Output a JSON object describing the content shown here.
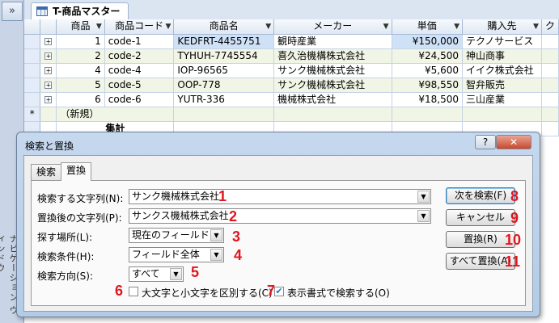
{
  "nav": {
    "toggle": "»",
    "vertical_label": "ナビゲーション ウィンドウ"
  },
  "doc_tab": {
    "title": "T-商品マスター"
  },
  "datasheet": {
    "columns": [
      "商品",
      "商品コード",
      "商品名",
      "メーカー",
      "単価",
      "購入先",
      "ク"
    ],
    "rows": [
      {
        "id": "1",
        "code": "code-1",
        "name": "KEDFRT-4455751",
        "maker": "観時産業",
        "price": "¥150,000",
        "vendor": "テクノサービス"
      },
      {
        "id": "2",
        "code": "code-2",
        "name": "TYHUH-7745554",
        "maker": "喜久治機構株式会社",
        "price": "¥24,500",
        "vendor": "神山商事"
      },
      {
        "id": "4",
        "code": "code-4",
        "name": "IOP-96565",
        "maker": "サンク機械株式会社",
        "price": "¥5,600",
        "vendor": "イイク株式会社"
      },
      {
        "id": "5",
        "code": "code-5",
        "name": "OOP-778",
        "maker": "サンク機械株式会社",
        "price": "¥98,550",
        "vendor": "智弁販売"
      },
      {
        "id": "6",
        "code": "code-6",
        "name": "YUTR-336",
        "maker": "機械株式会社",
        "price": "¥18,500",
        "vendor": "三山産業"
      }
    ],
    "new_record_marker": "*",
    "new_record_label": "（新規）",
    "totals_label": "集計"
  },
  "dialog": {
    "title": "検索と置換",
    "help_button": "?",
    "close_button": "✕",
    "tabs": [
      "検索",
      "置換"
    ],
    "active_tab": "置換",
    "fields": {
      "find_label": "検索する文字列(N):",
      "find_value": "サンク機械株式会社",
      "replace_label": "置換後の文字列(P):",
      "replace_value": "サンクス機械株式会社",
      "look_in_label": "探す場所(L):",
      "look_in_value": "現在のフィールド",
      "match_label": "検索条件(H):",
      "match_value": "フィールド全体",
      "search_label": "検索方向(S):",
      "search_value": "すべて",
      "match_case_label": "大文字と小文字を区別する(C)",
      "match_case_checked": false,
      "search_formatted_label": "表示書式で検索する(O)",
      "search_formatted_checked": true
    },
    "buttons": {
      "find_next": "次を検索(F)",
      "cancel": "キャンセル",
      "replace": "置換(R)",
      "replace_all": "すべて置換(A)"
    }
  },
  "annotations": [
    "1",
    "2",
    "3",
    "4",
    "5",
    "6",
    "7",
    "8",
    "9",
    "10",
    "11"
  ],
  "colors": {
    "annotation": "#e0161e",
    "selection": "#cfe1f7"
  }
}
